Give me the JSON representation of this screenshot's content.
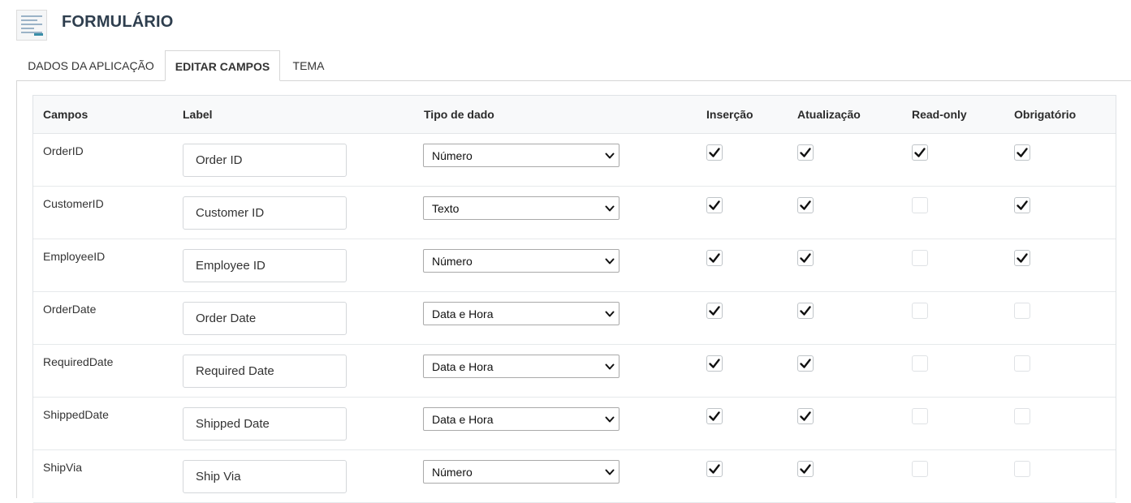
{
  "app": {
    "title": "FORMULÁRIO"
  },
  "tabs": [
    {
      "label": "DADOS DA APLICAÇÃO",
      "active": false
    },
    {
      "label": "EDITAR CAMPOS",
      "active": true
    },
    {
      "label": "TEMA",
      "active": false
    }
  ],
  "table": {
    "headers": {
      "campos": "Campos",
      "label": "Label",
      "tipo": "Tipo de dado",
      "insercao": "Inserção",
      "atualizacao": "Atualização",
      "readonly": "Read-only",
      "obrigatorio": "Obrigatório"
    },
    "rows": [
      {
        "field": "OrderID",
        "label": "Order ID",
        "type": "Número",
        "insercao": true,
        "atualizacao": true,
        "readonly": true,
        "obrigatorio": true
      },
      {
        "field": "CustomerID",
        "label": "Customer ID",
        "type": "Texto",
        "insercao": true,
        "atualizacao": true,
        "readonly": false,
        "obrigatorio": true
      },
      {
        "field": "EmployeeID",
        "label": "Employee ID",
        "type": "Número",
        "insercao": true,
        "atualizacao": true,
        "readonly": false,
        "obrigatorio": true
      },
      {
        "field": "OrderDate",
        "label": "Order Date",
        "type": "Data e Hora",
        "insercao": true,
        "atualizacao": true,
        "readonly": false,
        "obrigatorio": false
      },
      {
        "field": "RequiredDate",
        "label": "Required Date",
        "type": "Data e Hora",
        "insercao": true,
        "atualizacao": true,
        "readonly": false,
        "obrigatorio": false
      },
      {
        "field": "ShippedDate",
        "label": "Shipped Date",
        "type": "Data e Hora",
        "insercao": true,
        "atualizacao": true,
        "readonly": false,
        "obrigatorio": false
      },
      {
        "field": "ShipVia",
        "label": "Ship Via",
        "type": "Número",
        "insercao": true,
        "atualizacao": true,
        "readonly": false,
        "obrigatorio": false
      }
    ]
  }
}
